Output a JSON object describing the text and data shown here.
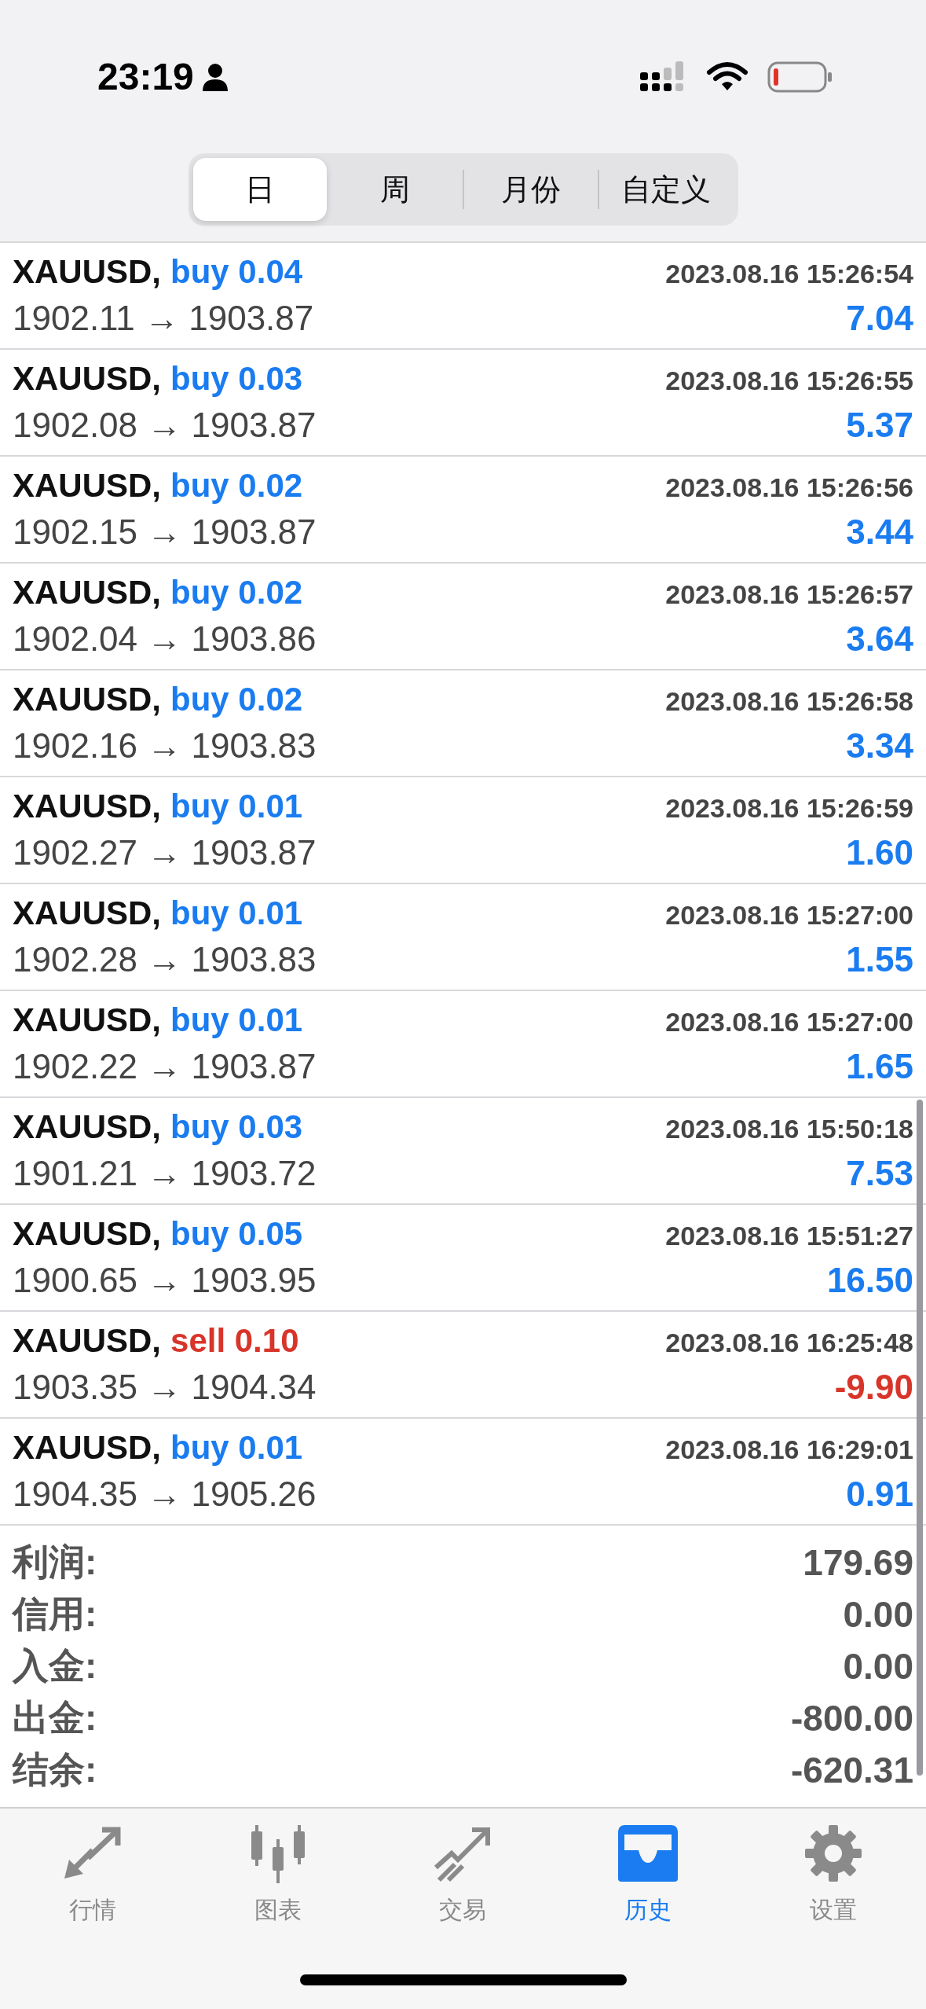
{
  "status_bar": {
    "time": "23:19"
  },
  "segments": [
    {
      "label": "日",
      "selected": true
    },
    {
      "label": "周",
      "selected": false
    },
    {
      "label": "月份",
      "selected": false
    },
    {
      "label": "自定义",
      "selected": false
    }
  ],
  "trades": [
    {
      "symbol": "XAUUSD,",
      "kind": "buy",
      "direction": "buy 0.04",
      "time": "2023.08.16 15:26:54",
      "prices": "1902.11 → 1903.87",
      "profit": "7.04"
    },
    {
      "symbol": "XAUUSD,",
      "kind": "buy",
      "direction": "buy 0.03",
      "time": "2023.08.16 15:26:55",
      "prices": "1902.08 → 1903.87",
      "profit": "5.37"
    },
    {
      "symbol": "XAUUSD,",
      "kind": "buy",
      "direction": "buy 0.02",
      "time": "2023.08.16 15:26:56",
      "prices": "1902.15 → 1903.87",
      "profit": "3.44"
    },
    {
      "symbol": "XAUUSD,",
      "kind": "buy",
      "direction": "buy 0.02",
      "time": "2023.08.16 15:26:57",
      "prices": "1902.04 → 1903.86",
      "profit": "3.64"
    },
    {
      "symbol": "XAUUSD,",
      "kind": "buy",
      "direction": "buy 0.02",
      "time": "2023.08.16 15:26:58",
      "prices": "1902.16 → 1903.83",
      "profit": "3.34"
    },
    {
      "symbol": "XAUUSD,",
      "kind": "buy",
      "direction": "buy 0.01",
      "time": "2023.08.16 15:26:59",
      "prices": "1902.27 → 1903.87",
      "profit": "1.60"
    },
    {
      "symbol": "XAUUSD,",
      "kind": "buy",
      "direction": "buy 0.01",
      "time": "2023.08.16 15:27:00",
      "prices": "1902.28 → 1903.83",
      "profit": "1.55"
    },
    {
      "symbol": "XAUUSD,",
      "kind": "buy",
      "direction": "buy 0.01",
      "time": "2023.08.16 15:27:00",
      "prices": "1902.22 → 1903.87",
      "profit": "1.65"
    },
    {
      "symbol": "XAUUSD,",
      "kind": "buy",
      "direction": "buy 0.03",
      "time": "2023.08.16 15:50:18",
      "prices": "1901.21 → 1903.72",
      "profit": "7.53"
    },
    {
      "symbol": "XAUUSD,",
      "kind": "buy",
      "direction": "buy 0.05",
      "time": "2023.08.16 15:51:27",
      "prices": "1900.65 → 1903.95",
      "profit": "16.50"
    },
    {
      "symbol": "XAUUSD,",
      "kind": "sell",
      "direction": "sell 0.10",
      "time": "2023.08.16 16:25:48",
      "prices": "1903.35 → 1904.34",
      "profit": "-9.90"
    },
    {
      "symbol": "XAUUSD,",
      "kind": "buy",
      "direction": "buy 0.01",
      "time": "2023.08.16 16:29:01",
      "prices": "1904.35 → 1905.26",
      "profit": "0.91"
    }
  ],
  "summary": [
    {
      "label": "利润:",
      "value": "179.69"
    },
    {
      "label": "信用:",
      "value": "0.00"
    },
    {
      "label": "入金:",
      "value": "0.00"
    },
    {
      "label": "出金:",
      "value": "-800.00"
    },
    {
      "label": "结余:",
      "value": "-620.31"
    }
  ],
  "tab_bar": [
    {
      "label": "行情",
      "kind": "quotes",
      "selected": false
    },
    {
      "label": "图表",
      "kind": "chart",
      "selected": false
    },
    {
      "label": "交易",
      "kind": "trade",
      "selected": false
    },
    {
      "label": "历史",
      "kind": "history",
      "selected": true
    },
    {
      "label": "设置",
      "kind": "settings",
      "selected": false
    }
  ]
}
